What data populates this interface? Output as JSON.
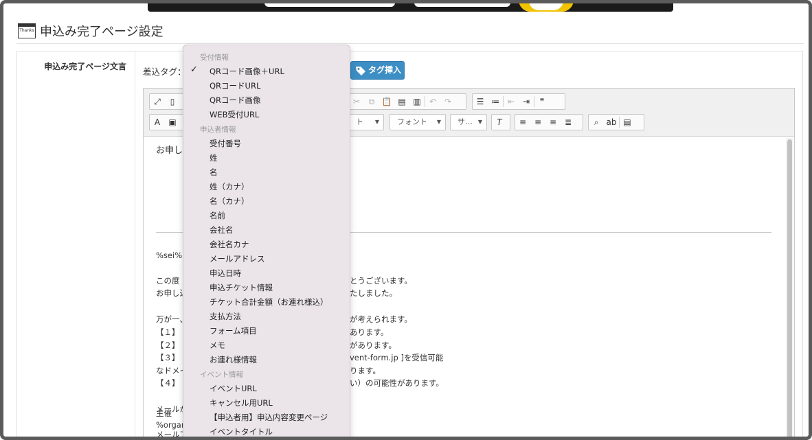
{
  "page": {
    "title": "申込み完了ページ設定",
    "title_icon_text": "Thanks"
  },
  "form": {
    "field_label": "申込み完了ページ文言",
    "insert_tag_label": "差込タグ：",
    "tag_insert_button": "タグ挿入"
  },
  "toolbar": {
    "font_combo": "フォント",
    "size_combo": "サ…",
    "format_combo": "ト"
  },
  "editor": {
    "lines": [
      "お申し",
      "%sei%",
      "この度",
      "とうございます。",
      "お申し込",
      "たしました。",
      "万が一、",
      "が考えられます。",
      "【１】",
      "あります。",
      "【２】",
      "があります。",
      "【３】",
      "vent-form.jp ]を受信可能",
      "なドメイ",
      "ります。",
      "【４】",
      "い）の可能性があります。",
      "メールが",
      "メールア",
      "主催",
      "%organ"
    ]
  },
  "dropdown": {
    "groups": [
      {
        "label": "受付情報",
        "items": [
          "QRコード画像＋URL",
          "QRコードURL",
          "QRコード画像",
          "WEB受付URL"
        ]
      },
      {
        "label": "申込者情報",
        "items": [
          "受付番号",
          "姓",
          "名",
          "姓（カナ）",
          "名（カナ）",
          "名前",
          "会社名",
          "会社名カナ",
          "メールアドレス",
          "申込日時",
          "申込チケット情報",
          "チケット合計金額（お連れ様込）",
          "支払方法",
          "フォーム項目",
          "メモ",
          "お連れ様情報"
        ]
      },
      {
        "label": "イベント情報",
        "items": [
          "イベントURL",
          "キャンセル用URL",
          "【申込者用】申込内容変更ページ",
          "イベントタイトル"
        ]
      }
    ],
    "checked_item": "QRコード画像＋URL"
  }
}
